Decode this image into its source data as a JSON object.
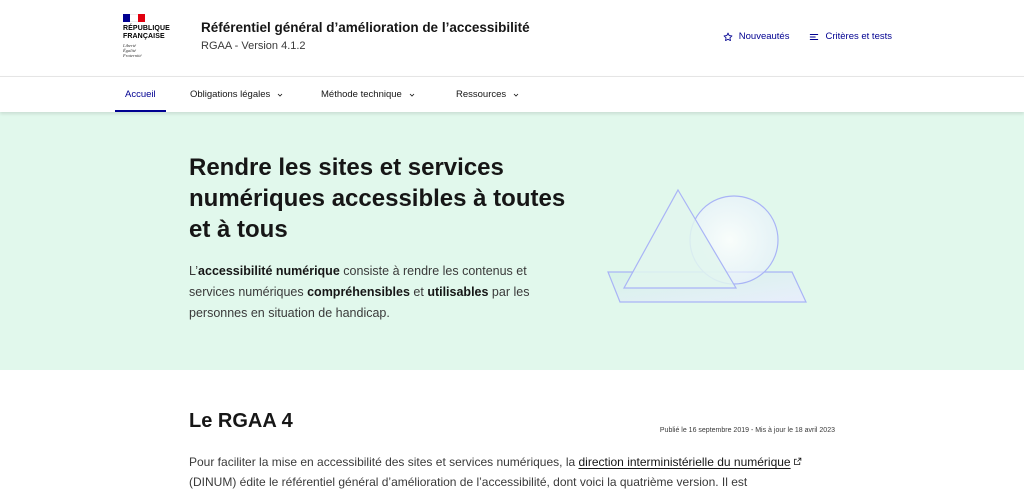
{
  "logo": {
    "line1": "RÉPUBLIQUE",
    "line2": "FRANÇAISE",
    "motto1": "Liberté",
    "motto2": "Égalité",
    "motto3": "Fraternité",
    "flag_colors": [
      "#000091",
      "#ffffff",
      "#e1000f"
    ]
  },
  "header": {
    "title": "Référentiel général d’amélioration de l’accessibilité",
    "subtitle": "RGAA - Version 4.1.2",
    "tools": [
      {
        "label": "Nouveautés",
        "icon": "star-icon"
      },
      {
        "label": "Critères et tests",
        "icon": "list-icon"
      }
    ]
  },
  "nav": {
    "items": [
      {
        "label": "Accueil",
        "active": true
      },
      {
        "label": "Obligations légales",
        "dropdown": true
      },
      {
        "label": "Méthode technique",
        "dropdown": true
      },
      {
        "label": "Ressources",
        "dropdown": true
      }
    ]
  },
  "hero": {
    "title": "Rendre les sites et services numériques accessibles à toutes et à tous",
    "text": {
      "p1": "L’",
      "b1": "accessibilité numérique",
      "p2": " consiste à rendre les contenus et services numériques ",
      "b2": "compréhensibles",
      "p3": " et ",
      "b3": "utilisables",
      "p4": " par les personnes en situation de handicap."
    },
    "background": "#e1f8ec"
  },
  "content": {
    "title": "Le RGAA 4",
    "meta": "Publié le 16 septembre 2019 - Mis à jour le 18 avril 2023",
    "p1": "Pour faciliter la mise en accessibilité des sites et services numériques, la ",
    "link": "direction interministérielle du numérique",
    "p2": " (DINUM) édite le référentiel général d’amélioration de l’accessibilité, dont voici la quatrième version. Il est"
  },
  "colors": {
    "accent": "#000091",
    "text": "#161616",
    "muted": "#3a3a3a"
  }
}
